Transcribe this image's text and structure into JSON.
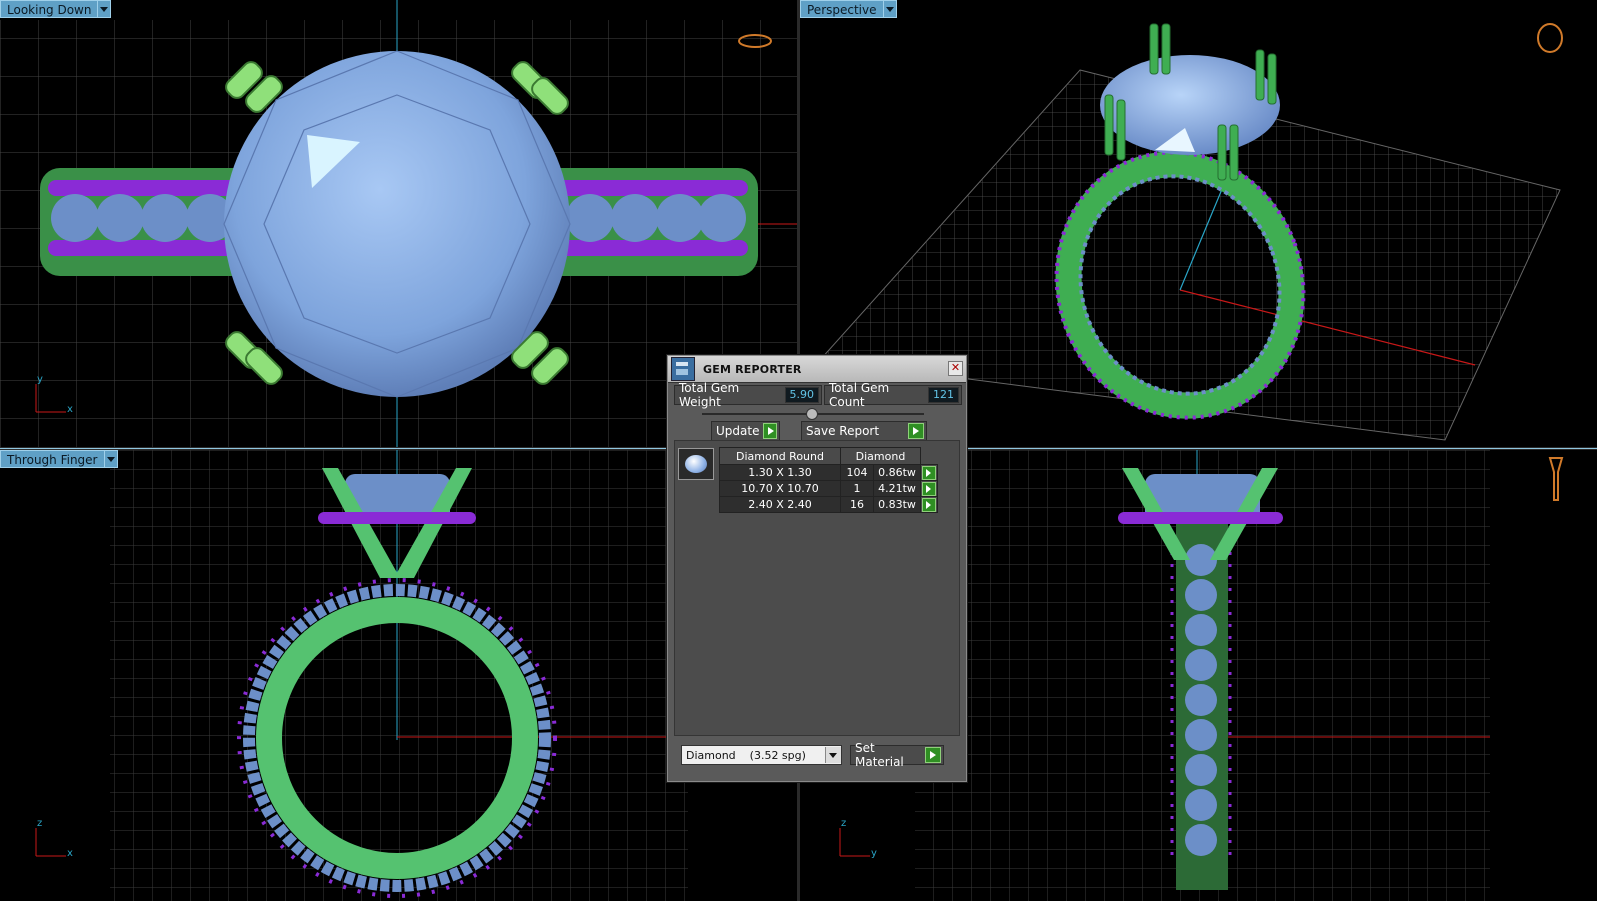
{
  "viewports": {
    "top_left": {
      "label": "Looking Down",
      "axis_h": "x",
      "axis_v": "y"
    },
    "top_right": {
      "label": "Perspective"
    },
    "bottom_left": {
      "label": "Through Finger",
      "axis_h": "x",
      "axis_v": "z"
    },
    "bottom_right": {
      "axis_h": "y",
      "axis_v": "z"
    }
  },
  "gem_reporter": {
    "title": "GEM REPORTER",
    "close_icon": "close-icon",
    "total_weight_label": "Total Gem Weight",
    "total_weight_value": "5.90",
    "total_count_label": "Total Gem Count",
    "total_count_value": "121",
    "update_label": "Update",
    "save_report_label": "Save Report",
    "table": {
      "headers": [
        "Diamond Round",
        "Diamond"
      ],
      "rows": [
        {
          "size": "1.30 X 1.30",
          "count": "104",
          "weight": "0.86tw"
        },
        {
          "size": "10.70 X 10.70",
          "count": "1",
          "weight": "4.21tw"
        },
        {
          "size": "2.40 X 2.40",
          "count": "16",
          "weight": "0.83tw"
        }
      ]
    },
    "material_select": "Diamond    (3.52 spg)",
    "set_material_label": "Set Material"
  },
  "colors": {
    "metal": "#3fae52",
    "gem": "#7fa8e0",
    "prong": "#8a2bd6",
    "grid": "#3a3a3a",
    "axis_x": "#d01818",
    "axis_y": "#2aa6c8"
  }
}
